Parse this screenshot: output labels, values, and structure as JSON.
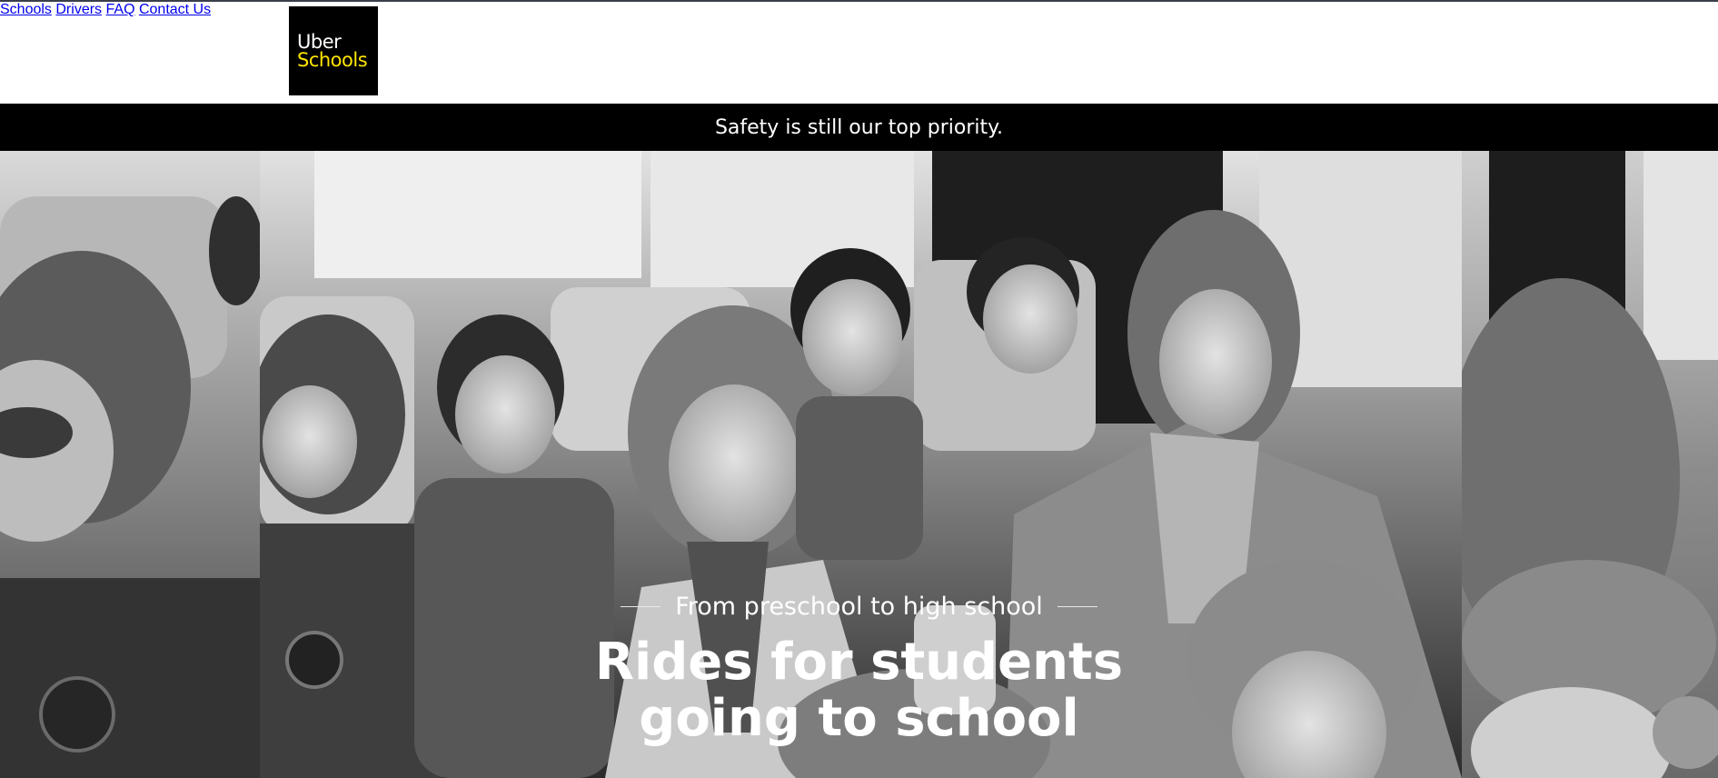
{
  "brand": {
    "line1": "Uber",
    "line2": "Schools",
    "background": "#000000",
    "line1_color": "#ffffff",
    "line2_color": "#ffe500"
  },
  "nav": {
    "items": [
      {
        "label": "Schools"
      },
      {
        "label": "Drivers"
      },
      {
        "label": "FAQ"
      },
      {
        "label": "Contact Us"
      }
    ]
  },
  "banner": {
    "text": "Safety is still our top priority.",
    "background": "#000000",
    "color": "#ffffff"
  },
  "hero": {
    "eyebrow": "From preschool to high school",
    "headline_line1": "Rides for students",
    "headline_line2": "going to school",
    "image_style": "black-and-white photo of children seated on a bus"
  }
}
